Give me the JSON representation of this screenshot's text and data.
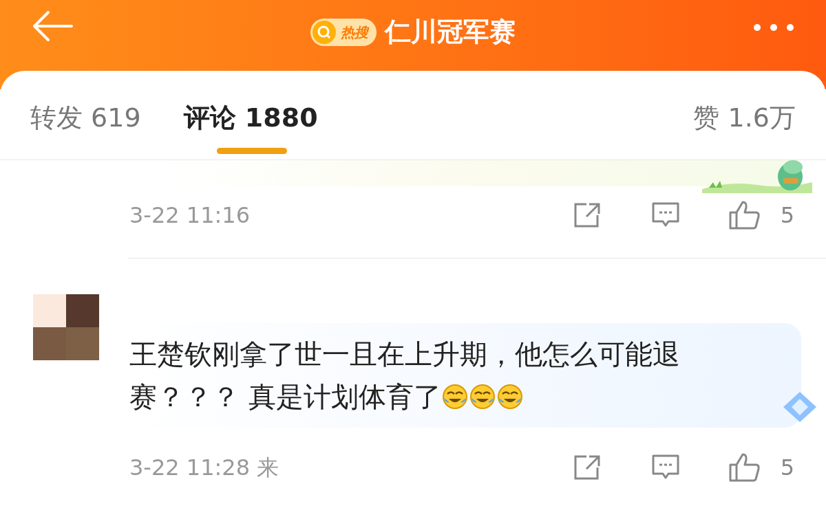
{
  "header": {
    "badge": "热搜",
    "title": "仁川冠军赛"
  },
  "tabs": [
    {
      "label": "转发 619",
      "selected": false
    },
    {
      "label": "评论 1880",
      "selected": true
    }
  ],
  "likes_total": "赞 1.6万",
  "comments": [
    {
      "kind": "partial",
      "meta": "3-22 11:16",
      "likes": "5"
    },
    {
      "kind": "full",
      "lines": [
        "王楚钦刚拿了世一且在上升期，他怎么可能退",
        "赛？？？ 真是计划体育了"
      ],
      "emojis": [
        {
          "kind": "laugh_cry"
        },
        {
          "kind": "laugh_cry"
        },
        {
          "kind": "laugh_cry"
        }
      ],
      "meta": "3-22 11:28 来",
      "likes": "5"
    }
  ]
}
